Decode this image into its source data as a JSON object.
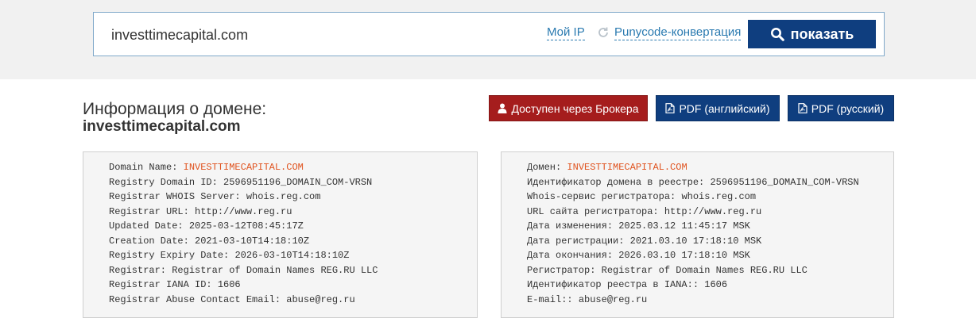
{
  "search": {
    "value": "investtimecapital.com",
    "my_ip_link": "Мой IP",
    "punycode_link": "Punycode-конвертация",
    "show_button": "показать"
  },
  "info": {
    "title": "Информация о домене:",
    "domain": "investtimecapital.com"
  },
  "actions": {
    "broker_button": "Доступен через Брокера",
    "pdf_en_button": "PDF (английский)",
    "pdf_ru_button": "PDF (русский)"
  },
  "colors": {
    "header_band": "#f1f1f1",
    "primary_button": "#0f3e7f",
    "broker_button": "#a51d1d",
    "link": "#2a7ab0",
    "domain_highlight": "#e0531f"
  },
  "icons": {
    "show_button": "search-icon",
    "broker_button": "user-icon",
    "pdf_buttons": "pdf-file-icon",
    "punycode": "refresh-icon"
  },
  "whois_en": [
    {
      "label": "Domain Name: ",
      "value": "INVESTTIMECAPITAL.COM"
    },
    {
      "label": "Registry Domain ID: ",
      "value": "2596951196_DOMAIN_COM-VRSN"
    },
    {
      "label": "Registrar WHOIS Server: ",
      "value": "whois.reg.com"
    },
    {
      "label": "Registrar URL: ",
      "value": "http://www.reg.ru"
    },
    {
      "label": "Updated Date: ",
      "value": "2025-03-12T08:45:17Z"
    },
    {
      "label": "Creation Date: ",
      "value": "2021-03-10T14:18:10Z"
    },
    {
      "label": "Registry Expiry Date: ",
      "value": "2026-03-10T14:18:10Z"
    },
    {
      "label": "Registrar: ",
      "value": "Registrar of Domain Names REG.RU LLC"
    },
    {
      "label": "Registrar IANA ID: ",
      "value": "1606"
    },
    {
      "label": "Registrar Abuse Contact Email: ",
      "value": "abuse@reg.ru"
    }
  ],
  "whois_ru": [
    {
      "label": "Домен: ",
      "value": "INVESTTIMECAPITAL.COM"
    },
    {
      "label": "Идентификатор домена в реестре: ",
      "value": "2596951196_DOMAIN_COM-VRSN"
    },
    {
      "label": "Whois-сервис регистратора: ",
      "value": "whois.reg.com"
    },
    {
      "label": "URL сайта регистратора: ",
      "value": "http://www.reg.ru"
    },
    {
      "label": "Дата изменения: ",
      "value": "2025.03.12 11:45:17 MSK"
    },
    {
      "label": "Дата регистрации: ",
      "value": "2021.03.10 17:18:10 MSK"
    },
    {
      "label": "Дата окончания: ",
      "value": "2026.03.10 17:18:10 MSK"
    },
    {
      "label": "Регистратор: ",
      "value": "Registrar of Domain Names REG.RU LLC"
    },
    {
      "label": "Идентификатор реестра в IANA:: ",
      "value": "1606"
    },
    {
      "label": "E-mail:: ",
      "value": "abuse@reg.ru"
    }
  ]
}
